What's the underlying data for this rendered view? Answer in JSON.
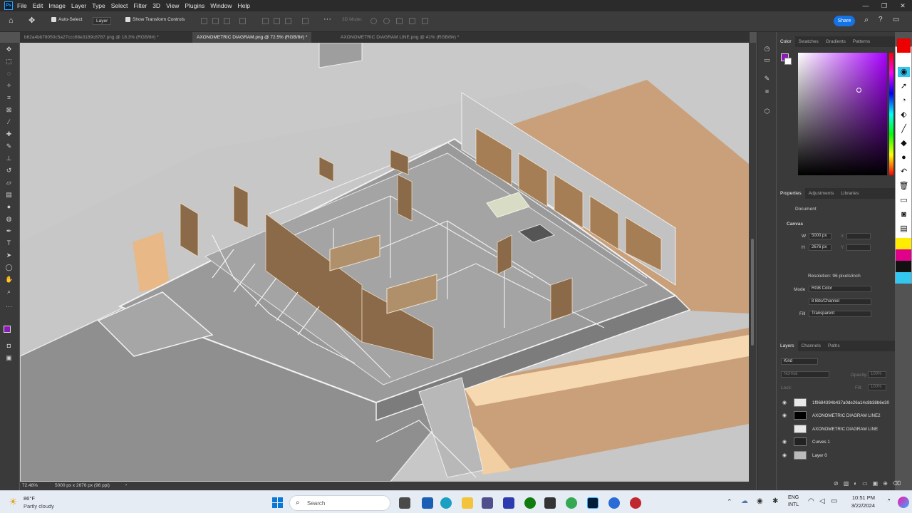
{
  "app": {
    "logo": "Ps"
  },
  "menu": [
    "File",
    "Edit",
    "Image",
    "Layer",
    "Type",
    "Select",
    "Filter",
    "3D",
    "View",
    "Plugins",
    "Window",
    "Help"
  ],
  "window_controls": [
    "—",
    "❐",
    "✕"
  ],
  "options": {
    "auto_select_label": "Auto-Select",
    "auto_select_target": "Layer",
    "show_transform_label": "Show Transform Controls",
    "mode_3d": "3D Mode:",
    "share_label": "Share"
  },
  "tabs": [
    {
      "label": "b62a4bb78050c5a27ccc68e3189c8787.png @ 18.3% (RGB/8#) *"
    },
    {
      "label": "AXONOMETRIC DIAGRAM.png @ 72.5% (RGB/8#) *"
    },
    {
      "label": "AXONOMETRIC DIAGRAM LINE.png @ 41% (RGB/8#) *"
    }
  ],
  "status": {
    "zoom": "72.48%",
    "doc_info": "5000 px x 2676 px (96 ppi)"
  },
  "color_panel": {
    "tabs": [
      "Color",
      "Swatches",
      "Gradients",
      "Patterns"
    ],
    "foreground": "#8a1bb5",
    "background": "#ffffff"
  },
  "properties": {
    "tabs": [
      "Properties",
      "Adjustments",
      "Libraries"
    ],
    "doc_label": "Document",
    "canvas_section": "Canvas",
    "w_label": "W",
    "w_value": "5000 px",
    "h_label": "H",
    "h_value": "2676 px",
    "x_label": "X",
    "y_label": "Y",
    "resolution": "Resolution: 96 pixels/inch",
    "mode_label": "Mode",
    "mode_value": "RGB Color",
    "bits_value": "8 Bits/Channel",
    "fill_label": "Fill",
    "fill_value": "Transparent"
  },
  "layers": {
    "tabs": [
      "Layers",
      "Channels",
      "Paths"
    ],
    "filter_kind": "Kind",
    "blend_mode": "Normal",
    "opacity_label": "Opacity:",
    "opacity_value": "100%",
    "lock_label": "Lock:",
    "fill_label": "Fill:",
    "fill_value": "100%",
    "items": [
      {
        "name": "1f9684394b437a0de26a14c8b38b6e30",
        "visible": true
      },
      {
        "name": "AXONOMETRIC DIAGRAM LINE2",
        "visible": true
      },
      {
        "name": "AXONOMETRIC DIAGRAM LINE",
        "visible": false
      },
      {
        "name": "Curves 1",
        "visible": true
      },
      {
        "name": "Layer 0",
        "visible": true
      }
    ]
  },
  "taskbar": {
    "weather_temp": "86°F",
    "weather_desc": "Partly cloudy",
    "search_placeholder": "Search",
    "lang_1": "ENG",
    "lang_2": "INTL",
    "time": "10:51 PM",
    "date": "3/22/2024"
  }
}
